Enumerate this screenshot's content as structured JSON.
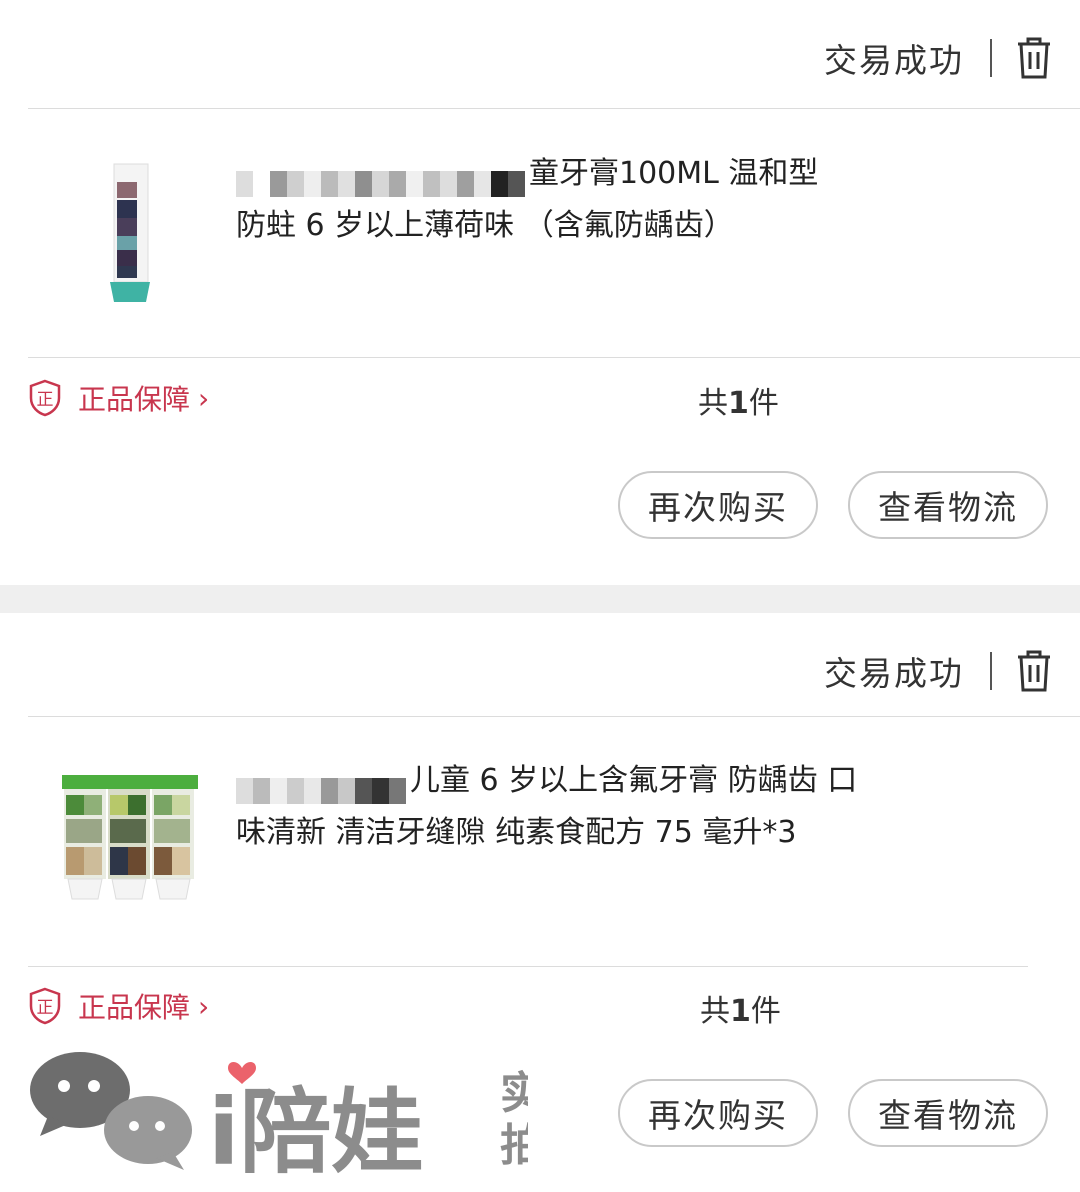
{
  "orders": [
    {
      "status": "交易成功",
      "title_line1": "童牙膏100ML 温和型",
      "title_line2": "防蛀 6 岁以上薄荷味 （含氟防龋齿）",
      "guarantee": "正品保障",
      "guarantee_icon_char": "正",
      "count_prefix": "共",
      "count": "1",
      "count_suffix": "件",
      "rebuy": "再次购买",
      "logistics": "查看物流"
    },
    {
      "status": "交易成功",
      "title_line1": "儿童 6 岁以上含氟牙膏 防龋齿 口",
      "title_line2": "味清新 清洁牙缝隙 纯素食配方 75 毫升*3",
      "guarantee": "正品保障",
      "guarantee_icon_char": "正",
      "count_prefix": "共",
      "count": "1",
      "count_suffix": "件",
      "rebuy": "再次购买",
      "logistics": "查看物流"
    }
  ],
  "watermark": {
    "brand": "i陪娃",
    "tag_top": "实",
    "tag_bottom": "拍"
  },
  "colors": {
    "accent_red": "#c8364e",
    "separator": "#efefef"
  },
  "icons": [
    "trash-icon",
    "shield-icon",
    "chevron-right-icon",
    "chat-bubble-icon",
    "heart-icon"
  ]
}
